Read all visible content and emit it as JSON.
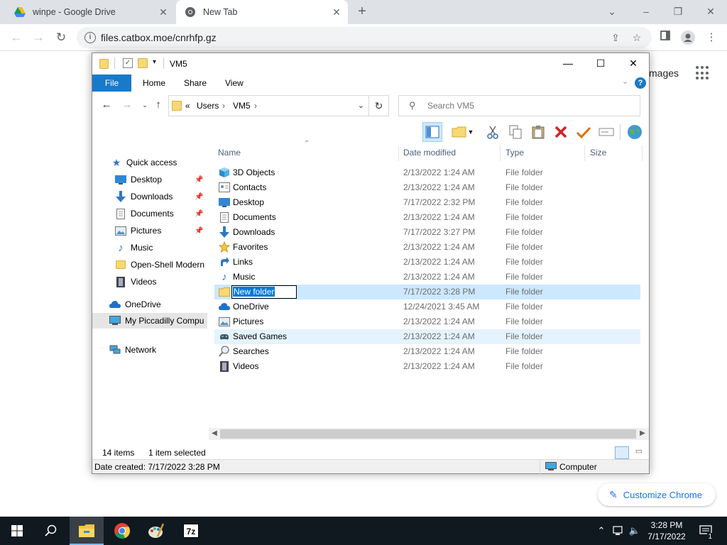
{
  "browser": {
    "tabs": [
      {
        "title": "winpe - Google Drive",
        "active": false,
        "favicon": "google-drive-icon"
      },
      {
        "title": "New Tab",
        "active": true,
        "favicon": "chrome-icon"
      }
    ],
    "url": "files.catbox.moe/cnrhfp.gz",
    "newtab_link": "mages",
    "customize_label": "Customize Chrome"
  },
  "explorer": {
    "title": "VM5",
    "ribbon_tabs": [
      "File",
      "Home",
      "Share",
      "View"
    ],
    "breadcrumb": {
      "prefix": "«",
      "items": [
        "Users",
        "VM5"
      ]
    },
    "search_placeholder": "Search VM5",
    "columns": {
      "name": "Name",
      "date": "Date modified",
      "type": "Type",
      "size": "Size"
    },
    "nav": {
      "quick_access": "Quick access",
      "items": [
        "Desktop",
        "Downloads",
        "Documents",
        "Pictures",
        "Music",
        "Open-Shell Modern",
        "Videos"
      ],
      "onedrive": "OneDrive",
      "this_pc": "My Piccadilly Compu",
      "network": "Network"
    },
    "files": [
      {
        "name": "3D Objects",
        "date": "2/13/2022 1:24 AM",
        "type": "File folder",
        "icon": "3d-objects-icon"
      },
      {
        "name": "Contacts",
        "date": "2/13/2022 1:24 AM",
        "type": "File folder",
        "icon": "contacts-icon"
      },
      {
        "name": "Desktop",
        "date": "7/17/2022 2:32 PM",
        "type": "File folder",
        "icon": "desktop-icon"
      },
      {
        "name": "Documents",
        "date": "2/13/2022 1:24 AM",
        "type": "File folder",
        "icon": "documents-icon"
      },
      {
        "name": "Downloads",
        "date": "7/17/2022 3:27 PM",
        "type": "File folder",
        "icon": "downloads-icon"
      },
      {
        "name": "Favorites",
        "date": "2/13/2022 1:24 AM",
        "type": "File folder",
        "icon": "favorites-icon"
      },
      {
        "name": "Links",
        "date": "2/13/2022 1:24 AM",
        "type": "File folder",
        "icon": "links-icon"
      },
      {
        "name": "Music",
        "date": "2/13/2022 1:24 AM",
        "type": "File folder",
        "icon": "music-icon"
      },
      {
        "name": "New folder",
        "date": "7/17/2022 3:28 PM",
        "type": "File folder",
        "icon": "folder-icon"
      },
      {
        "name": "OneDrive",
        "date": "12/24/2021 3:45 AM",
        "type": "File folder",
        "icon": "onedrive-icon"
      },
      {
        "name": "Pictures",
        "date": "2/13/2022 1:24 AM",
        "type": "File folder",
        "icon": "pictures-icon"
      },
      {
        "name": "Saved Games",
        "date": "2/13/2022 1:24 AM",
        "type": "File folder",
        "icon": "saved-games-icon"
      },
      {
        "name": "Searches",
        "date": "2/13/2022 1:24 AM",
        "type": "File folder",
        "icon": "searches-icon"
      },
      {
        "name": "Videos",
        "date": "2/13/2022 1:24 AM",
        "type": "File folder",
        "icon": "videos-icon"
      }
    ],
    "status": {
      "item_count": "14 items",
      "selected": "1 item selected",
      "date_created": "Date created: 7/17/2022 3:28 PM",
      "location": "Computer"
    }
  },
  "taskbar": {
    "time": "3:28 PM",
    "date": "7/17/2022",
    "notification_count": "1"
  },
  "colors": {
    "accent": "#1979ca",
    "selection": "#cce8ff",
    "taskbar": "#101820"
  }
}
